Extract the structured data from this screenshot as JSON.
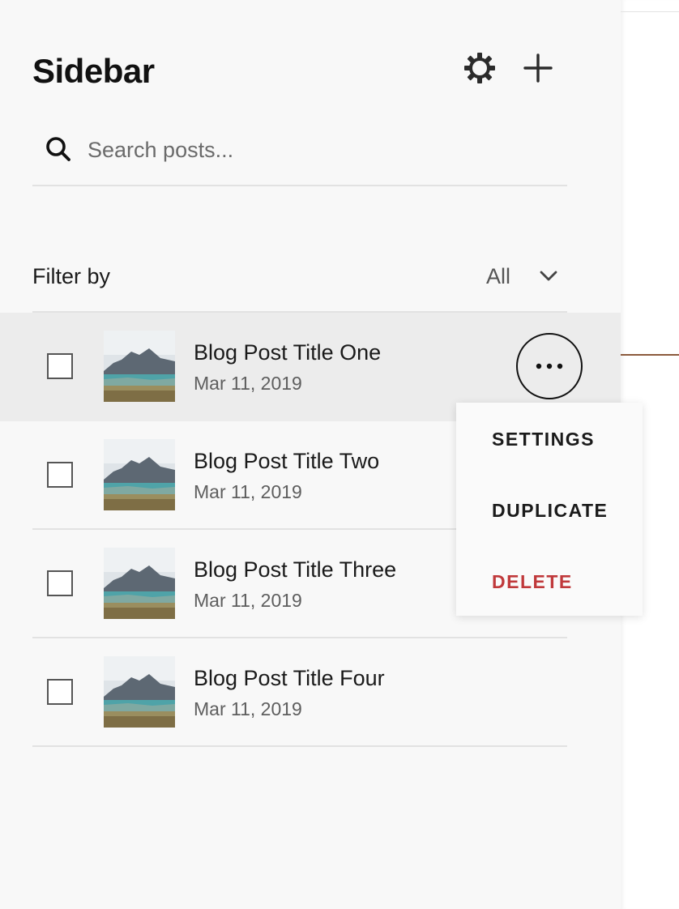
{
  "sidebar": {
    "title": "Sidebar",
    "search": {
      "placeholder": "Search posts...",
      "value": ""
    },
    "filter": {
      "label": "Filter by",
      "value": "All"
    },
    "posts": [
      {
        "title": "Blog Post Title One",
        "date": "Mar 11, 2019"
      },
      {
        "title": "Blog Post Title Two",
        "date": "Mar 11, 2019"
      },
      {
        "title": "Blog Post Title Three",
        "date": "Mar 11, 2019"
      },
      {
        "title": "Blog Post Title Four",
        "date": "Mar 11, 2019"
      }
    ]
  },
  "context_menu": {
    "items": [
      {
        "label": "SETTINGS"
      },
      {
        "label": "DUPLICATE"
      },
      {
        "label": "DELETE",
        "color": "#c0393b"
      }
    ]
  },
  "colors": {
    "sidebar_bg": "#f8f8f8",
    "selected_row_bg": "#ececec",
    "delete_red": "#c0393b",
    "accent_line": "#8b5a3c"
  },
  "icons": {
    "gear": "gear-icon",
    "add": "plus-icon",
    "search": "search-icon",
    "chevron": "chevron-down-icon",
    "more": "more-horizontal-icon"
  }
}
